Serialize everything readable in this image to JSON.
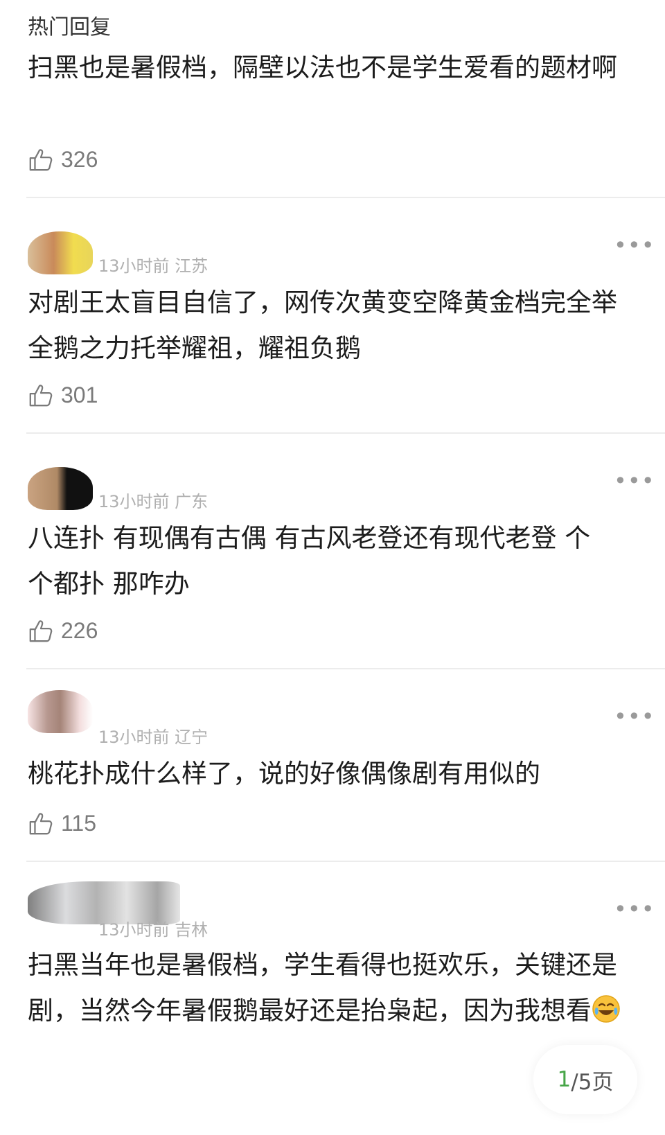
{
  "section_title": "热门回复",
  "comments": [
    {
      "meta": "",
      "text": "扫黑也是暑假档，隔壁以法也不是学生爱看的题材啊",
      "likes": "326"
    },
    {
      "meta": "13小时前 江苏",
      "text": "对剧王太盲目自信了，网传次黄变空降黄金档完全举全鹅之力托举耀祖，耀祖负鹅",
      "likes": "301"
    },
    {
      "meta": "13小时前 广东",
      "text": "八连扑 有现偶有古偶 有古风老登还有现代老登 个个都扑 那咋办",
      "likes": "226"
    },
    {
      "meta": "13小时前 辽宁",
      "text": "桃花扑成什么样了，说的好像偶像剧有用似的",
      "likes": "115"
    },
    {
      "meta": "13小时前 吉林",
      "text": "扫黑当年也是暑假档，学生看得也挺欢乐，关键还是剧，当然今年暑假鹅最好还是抬枭起，因为我想看",
      "likes": ""
    }
  ],
  "more_label": "•••",
  "pager": {
    "current": "1",
    "rest": "/5页"
  },
  "icons": {
    "like": "thumbs-up-icon",
    "more": "more-icon",
    "emoji": "laughing-tears-emoji"
  },
  "colors": {
    "meta": "#b0b0b0",
    "pager_current": "#46a547"
  }
}
